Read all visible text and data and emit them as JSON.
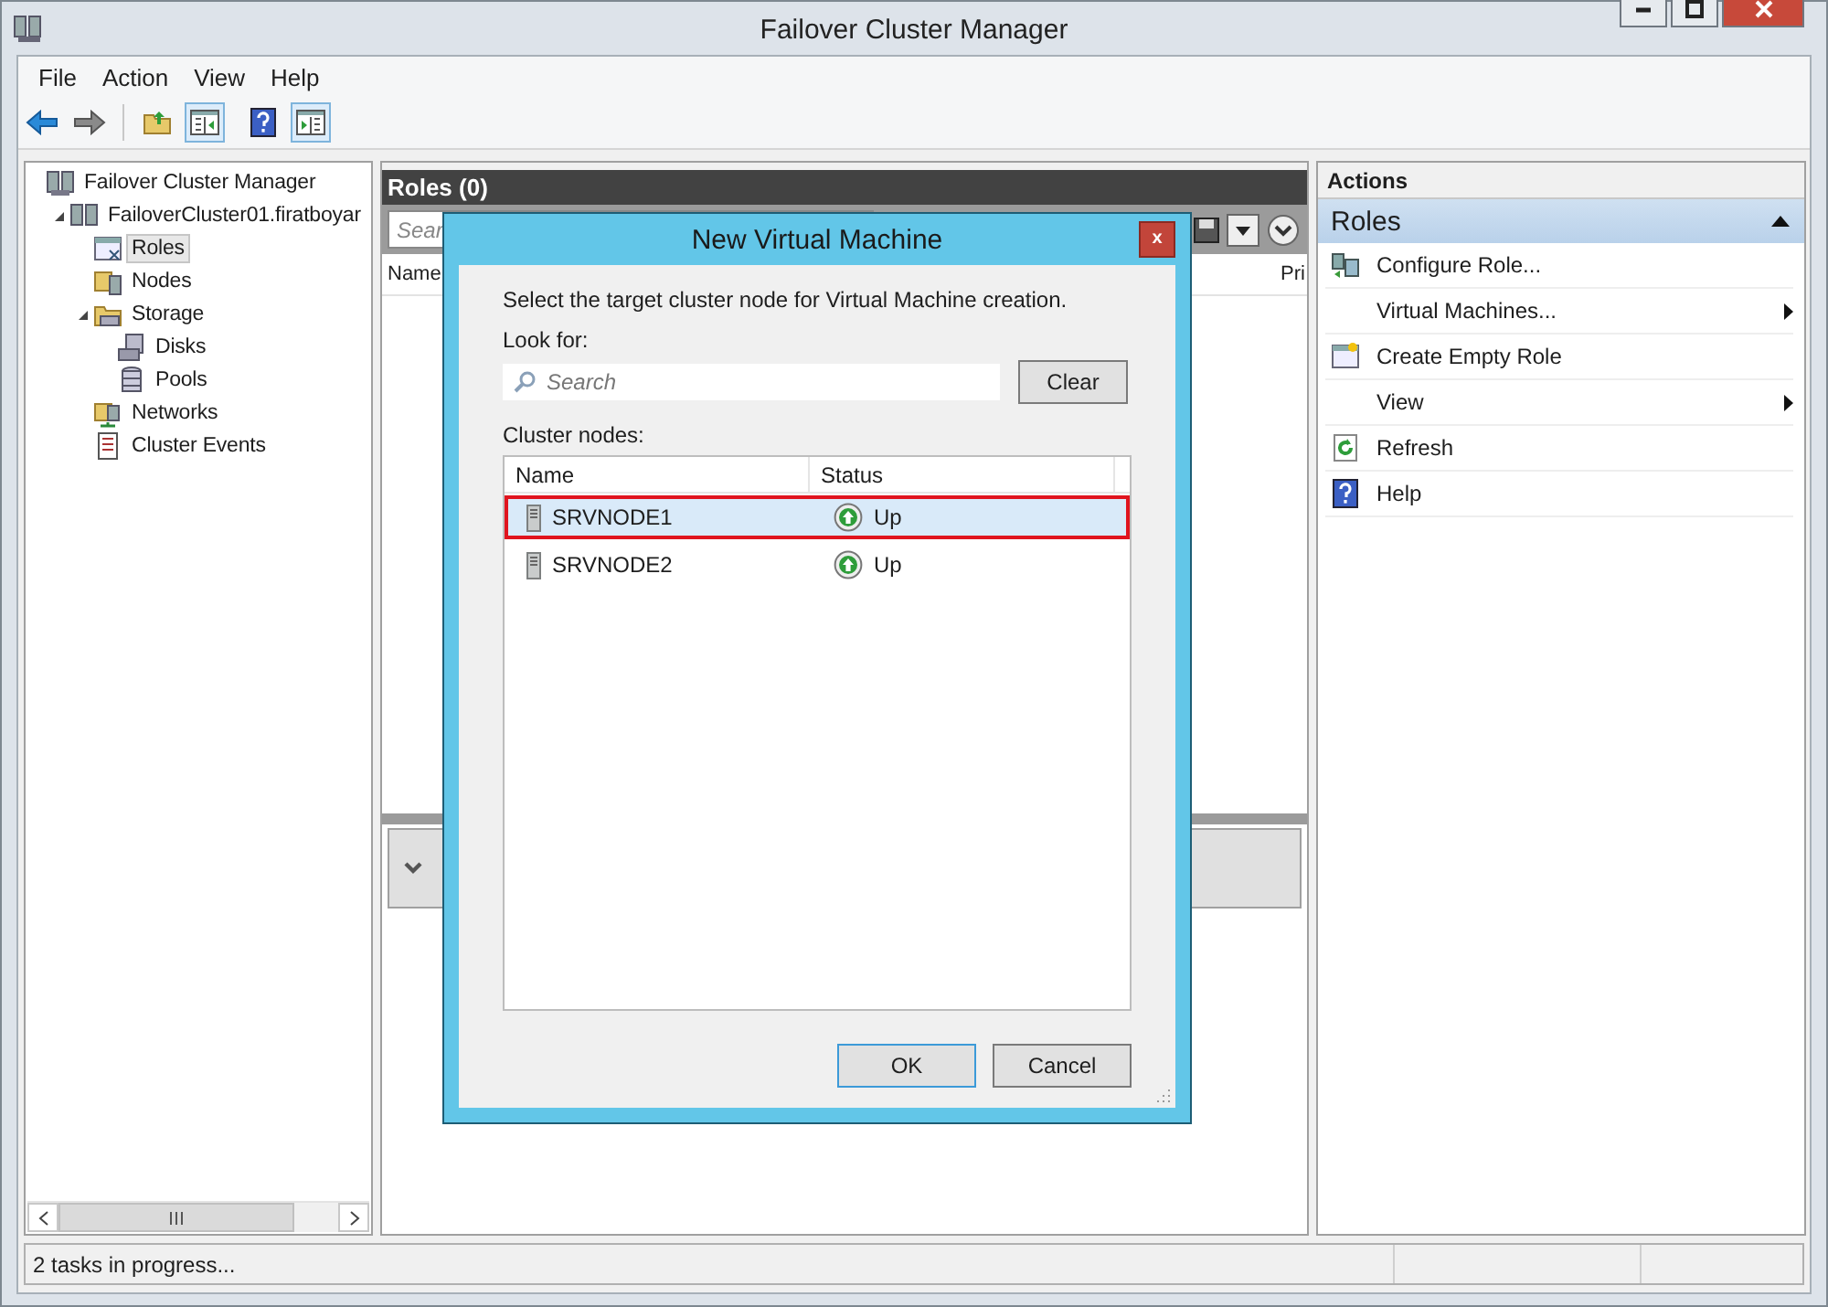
{
  "window": {
    "title": "Failover Cluster Manager"
  },
  "menu": [
    "File",
    "Action",
    "View",
    "Help"
  ],
  "tree": [
    {
      "label": "Failover Cluster Manager",
      "kind": "manager",
      "selected": false,
      "children": [
        {
          "label": "FailoverCluster01.firatboyar",
          "kind": "cluster",
          "selected": false,
          "expanded": true,
          "children": [
            {
              "label": "Roles",
              "kind": "roles",
              "selected": true
            },
            {
              "label": "Nodes",
              "kind": "nodes",
              "selected": false
            },
            {
              "label": "Storage",
              "kind": "storage",
              "selected": false,
              "expanded": true,
              "children": [
                {
                  "label": "Disks",
                  "kind": "disks",
                  "selected": false
                },
                {
                  "label": "Pools",
                  "kind": "pools",
                  "selected": false
                }
              ]
            },
            {
              "label": "Networks",
              "kind": "networks",
              "selected": false
            },
            {
              "label": "Cluster Events",
              "kind": "events",
              "selected": false
            }
          ]
        }
      ]
    }
  ],
  "roles_pane": {
    "title": "Roles (0)",
    "search_placeholder": "Sear",
    "columns": [
      "Name",
      "Pri"
    ]
  },
  "dialog": {
    "title": "New Virtual Machine",
    "close": "x",
    "instruction": "Select the target cluster node for Virtual Machine creation.",
    "look_for_label": "Look for:",
    "search": {
      "placeholder": "Search"
    },
    "clear_button": "Clear",
    "nodes_label": "Cluster nodes:",
    "columns": [
      "Name",
      "Status"
    ],
    "rows": [
      {
        "name": "SRVNODE1",
        "status": "Up",
        "selected": true,
        "highlighted": true
      },
      {
        "name": "SRVNODE2",
        "status": "Up",
        "selected": false,
        "highlighted": false
      }
    ],
    "buttons": [
      {
        "label": "OK",
        "default": true
      },
      {
        "label": "Cancel",
        "default": false
      }
    ]
  },
  "actions": {
    "title": "Actions",
    "section": {
      "label": "Roles",
      "expanded": true
    },
    "items": [
      {
        "label": "Configure Role...",
        "kind": "configure",
        "submenu": false
      },
      {
        "label": "Virtual Machines...",
        "kind": "plain",
        "submenu": true
      },
      {
        "label": "Create Empty Role",
        "kind": "create",
        "submenu": false
      },
      {
        "label": "View",
        "kind": "plain",
        "submenu": true
      },
      {
        "label": "Refresh",
        "kind": "refresh",
        "submenu": false
      },
      {
        "label": "Help",
        "kind": "help",
        "submenu": false
      }
    ]
  },
  "status_bar": {
    "text": "2 tasks in progress..."
  }
}
